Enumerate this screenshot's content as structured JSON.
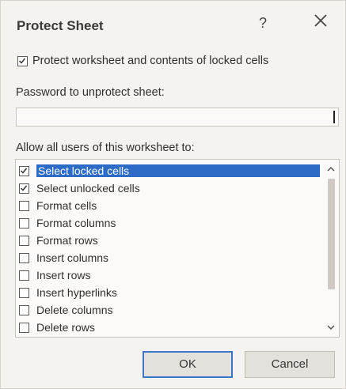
{
  "dialog": {
    "title": "Protect Sheet",
    "help": "?",
    "protect_label": "Protect worksheet and contents of locked cells",
    "protect_checked": true,
    "password_label": "Password to unprotect sheet:",
    "password_value": "",
    "allow_label": "Allow all users of this worksheet to:",
    "items": [
      {
        "label": "Select locked cells",
        "checked": true,
        "selected": true
      },
      {
        "label": "Select unlocked cells",
        "checked": true,
        "selected": false
      },
      {
        "label": "Format cells",
        "checked": false,
        "selected": false
      },
      {
        "label": "Format columns",
        "checked": false,
        "selected": false
      },
      {
        "label": "Format rows",
        "checked": false,
        "selected": false
      },
      {
        "label": "Insert columns",
        "checked": false,
        "selected": false
      },
      {
        "label": "Insert rows",
        "checked": false,
        "selected": false
      },
      {
        "label": "Insert hyperlinks",
        "checked": false,
        "selected": false
      },
      {
        "label": "Delete columns",
        "checked": false,
        "selected": false
      },
      {
        "label": "Delete rows",
        "checked": false,
        "selected": false
      }
    ],
    "ok_label": "OK",
    "cancel_label": "Cancel"
  }
}
